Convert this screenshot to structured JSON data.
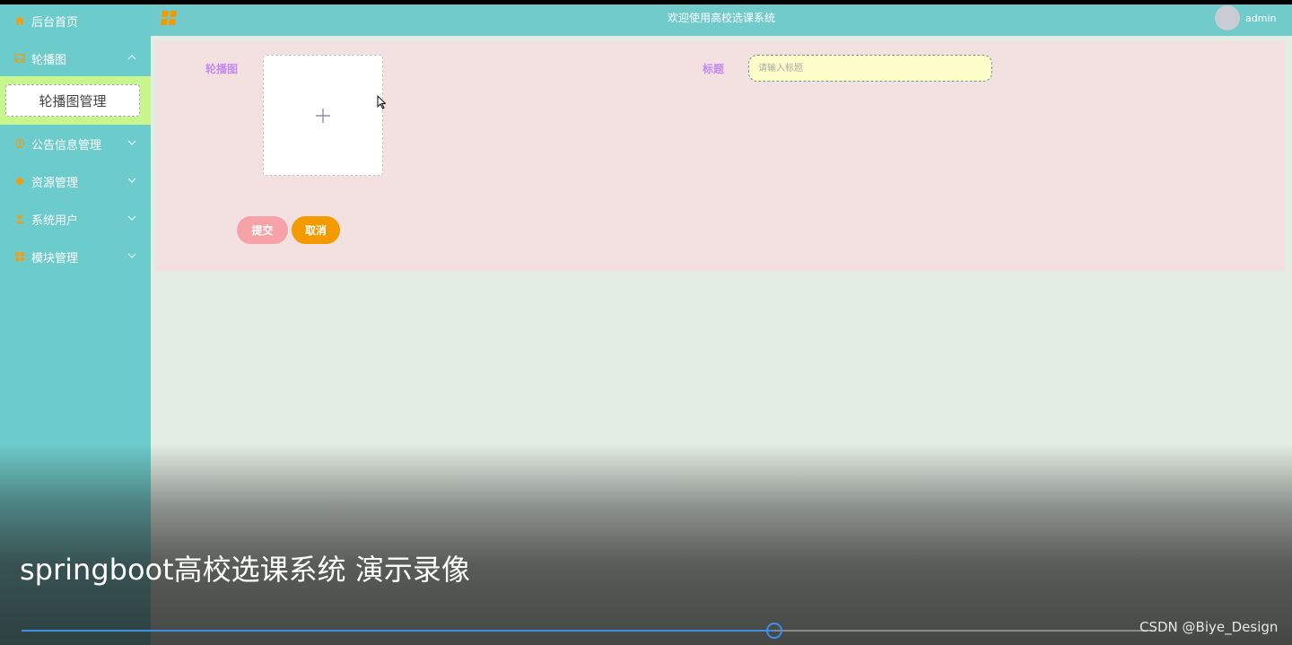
{
  "sidebar": {
    "items": [
      {
        "label": "后台首页",
        "icon": "home-icon"
      },
      {
        "label": "轮播图",
        "icon": "image-icon",
        "expanded": true
      },
      {
        "label": "公告信息管理",
        "icon": "notice-icon"
      },
      {
        "label": "资源管理",
        "icon": "diamond-icon"
      },
      {
        "label": "系统用户",
        "icon": "user-icon"
      },
      {
        "label": "模块管理",
        "icon": "grid-icon"
      }
    ],
    "active_sub": "轮播图管理"
  },
  "header": {
    "title": "欢迎使用高校选课系统",
    "username": "admin"
  },
  "form": {
    "carousel_label": "轮播图",
    "title_label": "标题",
    "title_placeholder": "请输入标题",
    "submit_label": "提交",
    "cancel_label": "取消"
  },
  "video": {
    "title": "springboot高校选课系统 演示录像",
    "progress": 0.666,
    "watermark": "CSDN @Biye_Design"
  },
  "colors": {
    "sidebar_bg": "#6ccbcb",
    "header_bg": "#72cbcb",
    "active_sub_bg": "#c8f58c",
    "form_bg": "#f3e0e0",
    "label_color": "#c58af2",
    "submit_bg": "#f5a2a8",
    "cancel_bg": "#f39a00",
    "progress_color": "#3c8ee6"
  }
}
